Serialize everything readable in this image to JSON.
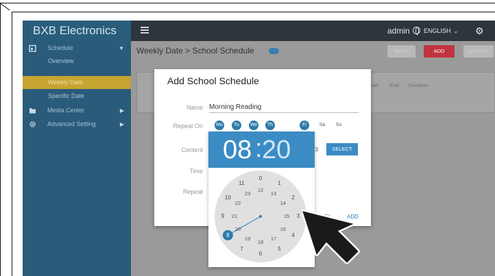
{
  "topbar": {
    "brand": "BXB Electronics",
    "user": "admin",
    "language": "ENGLISH"
  },
  "sidebar": {
    "items": [
      {
        "label": "Schedule",
        "icon": "calendar-icon"
      },
      {
        "label": "Media Center",
        "icon": "folder-icon"
      },
      {
        "label": "Advanced Setting",
        "icon": "gear-icon"
      }
    ],
    "sub_items": [
      {
        "label": "Overview"
      },
      {
        "label": "Weekly Date",
        "active": true
      },
      {
        "label": "Specific Date"
      }
    ]
  },
  "main": {
    "breadcrumb": "Weekly Date  >  School Schedule",
    "buttons": {
      "mass": "MASS",
      "add": "ADD",
      "delete": "DELETE"
    },
    "columns": [
      "Start",
      "End",
      "Duration"
    ]
  },
  "dialog": {
    "title": "Add School Schedule",
    "labels": {
      "name": "Name",
      "repeat_on": "Repeat On",
      "content": "Content",
      "time": "Time",
      "repeat": "Repeat"
    },
    "name_value": "Morning Reading",
    "days": [
      {
        "label": "Mo",
        "selected": true
      },
      {
        "label": "Tu",
        "selected": true
      },
      {
        "label": "We",
        "selected": true
      },
      {
        "label": "Th",
        "selected": true
      },
      {
        "label": "Fi",
        "selected": true
      },
      {
        "label": "Sa",
        "selected": false
      },
      {
        "label": "Su",
        "selected": false
      }
    ],
    "content_tail": "53",
    "select_button": "SELECT",
    "cancel_button": "ANCEL",
    "add_button": "ADD"
  },
  "clock": {
    "hour": "08",
    "colon": ":",
    "minute": "20",
    "outer_numbers": [
      "0",
      "1",
      "2",
      "3",
      "4",
      "5",
      "6",
      "7",
      "8",
      "9",
      "10",
      "11"
    ],
    "inner_numbers": [
      "12",
      "13",
      "14",
      "15",
      "16",
      "17",
      "18",
      "19",
      "20",
      "21",
      "22",
      "23"
    ],
    "selected_hour": 8
  },
  "colors": {
    "accent": "#3b8cc4",
    "sidebar": "#2b5b7a",
    "active_item": "#c6a431",
    "add_button": "#c0343e"
  }
}
